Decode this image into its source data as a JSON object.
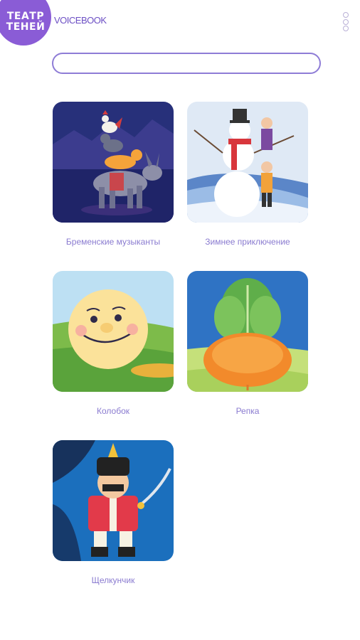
{
  "header": {
    "logo_lines": [
      "ТЕАТР",
      "ТЕНЕЙ"
    ],
    "brand": "VOICEBOOK",
    "menu_icon": "more-vertical-icon"
  },
  "search": {
    "value": "",
    "placeholder": ""
  },
  "stories": [
    {
      "title": "Бременские музыканты",
      "image": "bremen-musicians-illustration"
    },
    {
      "title": "Зимнее приключение",
      "image": "winter-snowman-illustration"
    },
    {
      "title": "Колобок",
      "image": "kolobok-illustration"
    },
    {
      "title": "Репка",
      "image": "turnip-illustration"
    },
    {
      "title": "Щелкунчик",
      "image": "nutcracker-illustration"
    }
  ],
  "colors": {
    "accent": "#8a5cd6",
    "caption": "#8a7bd0",
    "search_border": "#8e7cd6"
  }
}
